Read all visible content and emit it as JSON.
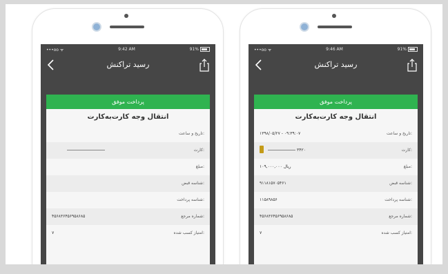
{
  "phones": [
    {
      "status": {
        "carrier": "•••oo ᯤ",
        "time": "9:42 AM",
        "battery": "91%"
      },
      "nav_title": "رسید تراکنش",
      "banner": "پرداخت موفق",
      "receipt_title": "انتقال وجه کارت‌به‌کارت",
      "rows": [
        {
          "label": "تاریخ و ساعت:",
          "value": ""
        },
        {
          "label": "کارت:",
          "value": ""
        },
        {
          "label": "مبلغ:",
          "value": ""
        },
        {
          "label": "شناسه قبض:",
          "value": ""
        },
        {
          "label": "شناسه پرداخت:",
          "value": ""
        },
        {
          "label": "شماره مرجع:",
          "value": "۴۵۶۸۳۶۴۵۶۹۵۸۶۸۵"
        },
        {
          "label": "امتیاز کسب شده:",
          "value": "۷"
        }
      ]
    },
    {
      "status": {
        "carrier": "•••oo ᯤ",
        "time": "9:46 AM",
        "battery": "91%"
      },
      "nav_title": "رسید تراکنش",
      "banner": "پرداخت موفق",
      "receipt_title": "انتقال وجه کارت‌به‌کارت",
      "rows": [
        {
          "label": "تاریخ و ساعت:",
          "value": "۱۳۹۸/۰۵/۲۷ - ۰۹:۳۹:۰۷"
        },
        {
          "label": "کارت:",
          "value": "۳۴۲۰"
        },
        {
          "label": "مبلغ:",
          "value": "۱۰۹,۰۰۰,۰۰۰ ریال"
        },
        {
          "label": "شناسه قبض:",
          "value": "۹۱۱۸۱۵۷۰۵۴۶۱"
        },
        {
          "label": "شناسه پرداخت:",
          "value": "۱۱۵۸۹۸۵۶"
        },
        {
          "label": "شماره مرجع:",
          "value": "۴۵۶۸۳۶۴۵۶۹۵۸۶۸۵"
        },
        {
          "label": "امتیاز کسب شده:",
          "value": "۷"
        }
      ]
    }
  ]
}
